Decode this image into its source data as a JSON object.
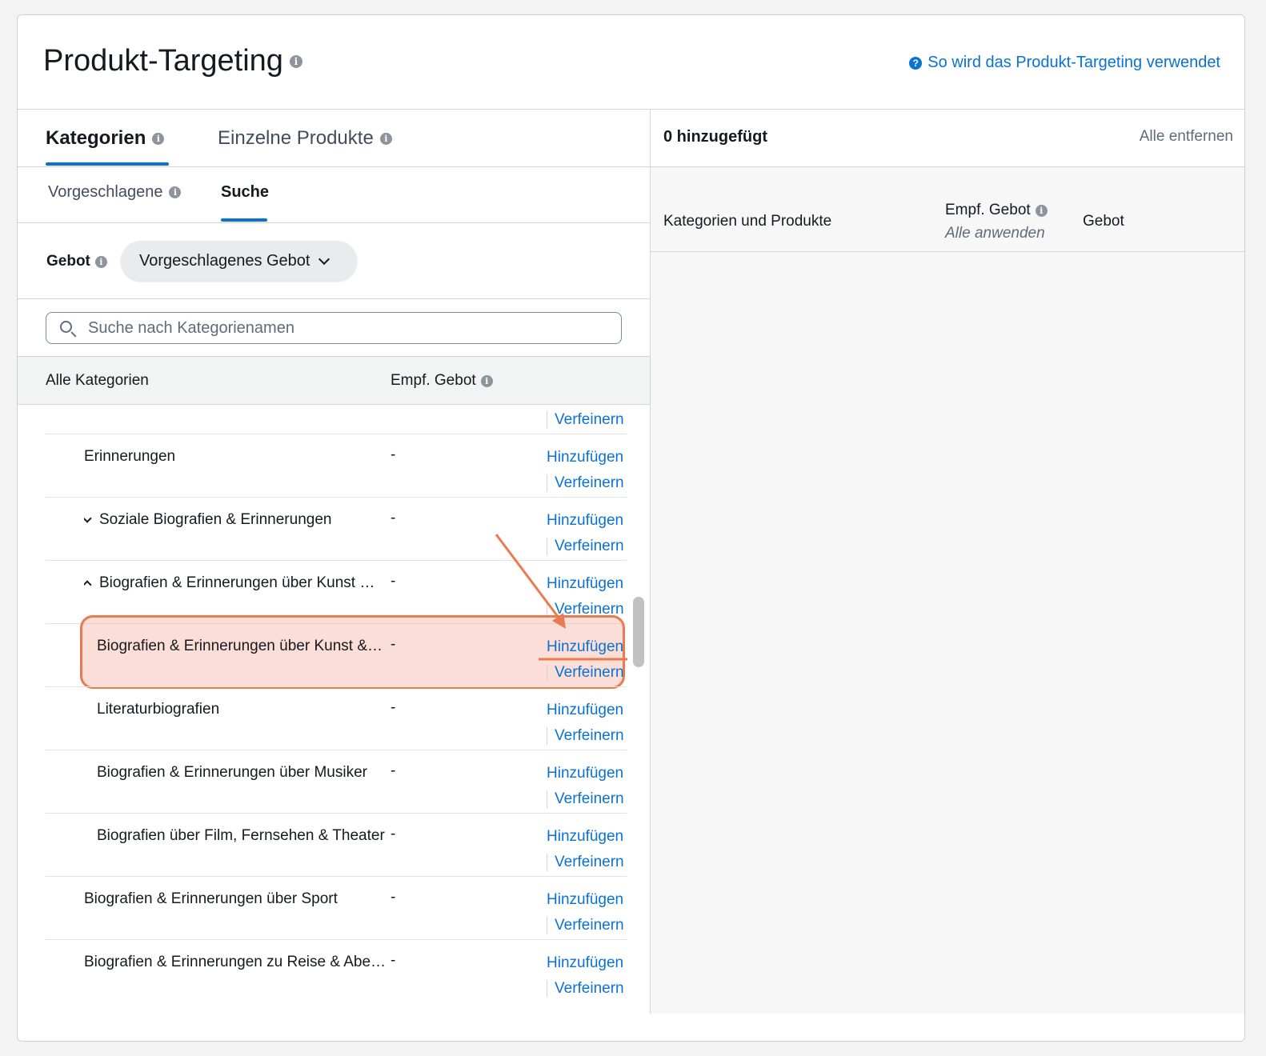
{
  "header": {
    "title": "Produkt-Targeting",
    "help_link": "So wird das Produkt-Targeting verwendet"
  },
  "tabs": [
    "Kategorien",
    "Einzelne Produkte"
  ],
  "subtabs": [
    "Vorgeschlagene",
    "Suche"
  ],
  "bid": {
    "label": "Gebot",
    "dropdown": "Vorgeschlagenes Gebot"
  },
  "search": {
    "placeholder": "Suche nach Kategorienamen"
  },
  "columns": {
    "category": "Alle Kategorien",
    "bid": "Empf. Gebot"
  },
  "actions": {
    "add": "Hinzufügen",
    "refine": "Verfeinern"
  },
  "rows": [
    {
      "name": "Erinnerungen",
      "bid": "-"
    },
    {
      "name": "Soziale Biografien & Erinnerungen",
      "bid": "-"
    },
    {
      "name": "Biografien & Erinnerungen über Kunst …",
      "bid": "-"
    },
    {
      "name": "Biografien & Erinnerungen über Kunst &…",
      "bid": "-"
    },
    {
      "name": "Literaturbiografien",
      "bid": "-"
    },
    {
      "name": "Biografien & Erinnerungen über Musiker",
      "bid": "-"
    },
    {
      "name": "Biografien über Film, Fernsehen & Theater",
      "bid": "-"
    },
    {
      "name": "Biografien & Erinnerungen über Sport",
      "bid": "-"
    },
    {
      "name": "Biografien & Erinnerungen zu Reise & Abe…",
      "bid": "-"
    }
  ],
  "right": {
    "count": "0 hinzugefügt",
    "remove_all": "Alle entfernen",
    "col_items": "Kategorien und Produkte",
    "col_bid": "Empf. Gebot",
    "apply_all": "Alle anwenden",
    "col_gebot": "Gebot"
  },
  "colors": {
    "accent": "#0972d3",
    "highlight": "#ea7b4f"
  }
}
